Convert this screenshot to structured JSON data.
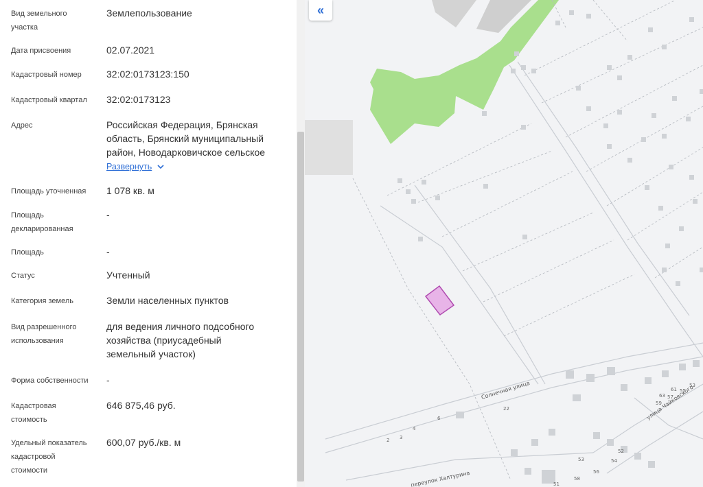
{
  "properties": [
    {
      "id": "land-type",
      "label_lines": [
        "Вид земельного",
        "участка"
      ],
      "value_lines": [
        "Землепользование"
      ]
    },
    {
      "id": "assign-date",
      "label_lines": [
        "Дата присвоения"
      ],
      "value_lines": [
        "02.07.2021"
      ]
    },
    {
      "id": "cadastral-number",
      "label_lines": [
        "Кадастровый номер"
      ],
      "value_lines": [
        "32:02:0173123:150"
      ]
    },
    {
      "id": "cadastral-quarter",
      "label_lines": [
        "Кадастровый квартал"
      ],
      "value_lines": [
        "32:02:0173123"
      ]
    },
    {
      "id": "address",
      "label_lines": [
        "Адрес"
      ],
      "value_lines": [
        "Российская Федерация, Брянская",
        "область, Брянский муниципальный",
        "район, Новодарковичское сельское"
      ]
    },
    {
      "id": "area-refined",
      "label_lines": [
        "Площадь уточненная"
      ],
      "value_lines": [
        "1 078 кв. м"
      ]
    },
    {
      "id": "area-declared",
      "label_lines": [
        "Площадь",
        "декларированная"
      ],
      "value_lines": [
        "-"
      ]
    },
    {
      "id": "area",
      "label_lines": [
        "Площадь"
      ],
      "value_lines": [
        "-"
      ]
    },
    {
      "id": "status",
      "label_lines": [
        "Статус"
      ],
      "value_lines": [
        "Учтенный"
      ]
    },
    {
      "id": "land-category",
      "label_lines": [
        "Категория земель"
      ],
      "value_lines": [
        "Земли населенных пунктов"
      ]
    },
    {
      "id": "permitted-use",
      "label_lines": [
        "Вид разрешенного",
        "использования"
      ],
      "value_lines": [
        "для ведения личного подсобного",
        "хозяйства (приусадебный",
        "земельный участок)"
      ]
    },
    {
      "id": "ownership-form",
      "label_lines": [
        "Форма собственности"
      ],
      "value_lines": [
        "-"
      ]
    },
    {
      "id": "cadastral-value",
      "label_lines": [
        "Кадастровая",
        "стоимость"
      ],
      "value_lines": [
        "646 875,46 руб."
      ]
    },
    {
      "id": "specific-value",
      "label_lines": [
        "Удельный показатель",
        "кадастровой",
        "стоимости"
      ],
      "value_lines": [
        "600,07 руб./кв. м"
      ]
    }
  ],
  "address_expand_label": "Развернуть",
  "icons": {
    "expand": "chevron-down-icon",
    "collapse": "double-chevron-left-icon"
  },
  "map": {
    "streets": {
      "sun": "Солнечная улица",
      "tchaikovsky": "улица Чайковского",
      "khalturin": "переулок Халтурина"
    },
    "house_numbers": [
      {
        "t": "22"
      },
      {
        "t": "6"
      },
      {
        "t": "4"
      },
      {
        "t": "2"
      },
      {
        "t": "3"
      },
      {
        "t": "63"
      },
      {
        "t": "61"
      },
      {
        "t": "59"
      },
      {
        "t": "57"
      },
      {
        "t": "55"
      },
      {
        "t": "53"
      },
      {
        "t": "52"
      },
      {
        "t": "54"
      },
      {
        "t": "56"
      },
      {
        "t": "58"
      },
      {
        "t": "51"
      },
      {
        "t": "53"
      }
    ]
  },
  "colors": {
    "link": "#2f6fd6",
    "green_area": "#a9df8d",
    "parcel": "#c85ec8"
  }
}
